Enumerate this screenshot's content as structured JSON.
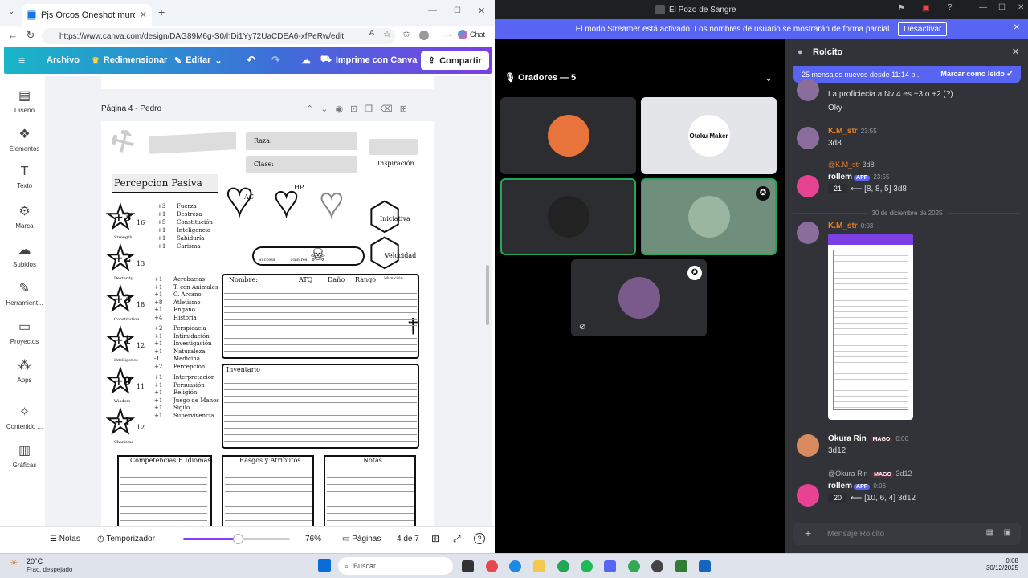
{
  "browser": {
    "tab_title": "Pjs Orcos Oneshot murder hobo",
    "new_tab_icon": "plus-icon",
    "url": "https://www.canva.com/design/DAG89M6g-S0/hDi1Yy72UaCDEA6-xfPeRw/edit",
    "chat_label": "Chat"
  },
  "canva": {
    "toolbar": {
      "archivo": "Archivo",
      "redimensionar": "Redimensionar",
      "editar": "Editar",
      "imprime": "Imprime con Canva",
      "compartir": "Compartir"
    },
    "sidebar": [
      {
        "label": "Diseño",
        "icon": "layout-icon"
      },
      {
        "label": "Elementos",
        "icon": "shapes-icon"
      },
      {
        "label": "Texto",
        "icon": "text-icon"
      },
      {
        "label": "Marca",
        "icon": "brand-icon"
      },
      {
        "label": "Subidos",
        "icon": "cloud-upload-icon"
      },
      {
        "label": "Herramient...",
        "icon": "tools-icon"
      },
      {
        "label": "Proyectos",
        "icon": "folder-icon"
      },
      {
        "label": "Apps",
        "icon": "apps-icon"
      },
      {
        "label": "Contenido ...",
        "icon": "magic-icon"
      },
      {
        "label": "Gráficas",
        "icon": "chart-icon"
      }
    ],
    "page_title": "Página 4 - Pedro",
    "sheet": {
      "raza": "Raza:",
      "clase": "Clase:",
      "inspiracion": "Inspiración",
      "percepcion": "Percepcion Pasiva",
      "ac": "AC",
      "hp": "HP",
      "iniciativa": "Iniciativa",
      "velocidad": "Velocidad",
      "exitos": "Success",
      "fallos": "Failures",
      "save_lines": [
        {
          "mod": "+3",
          "name": "Fuerza"
        },
        {
          "mod": "+1",
          "name": "Destreza"
        },
        {
          "mod": "+5",
          "name": "Constitución"
        },
        {
          "mod": "+1",
          "name": "Inteligencia"
        },
        {
          "mod": "+1",
          "name": "Sabiduría"
        },
        {
          "mod": "+1",
          "name": "Carisma"
        }
      ],
      "stats": [
        {
          "mod": "+3",
          "score": "16",
          "label": "Strength"
        },
        {
          "mod": "+2",
          "score": "13",
          "label": "Dexterity"
        },
        {
          "mod": "+3",
          "score": "18",
          "label": "Constitution"
        },
        {
          "mod": "+1",
          "score": "12",
          "label": "Intelligence"
        },
        {
          "mod": "+0",
          "score": "11",
          "label": "Wisdom"
        },
        {
          "mod": "+1",
          "score": "12",
          "label": "Charisma"
        }
      ],
      "skills": [
        {
          "mod": "+1",
          "name": "Acrobacias"
        },
        {
          "mod": "+1",
          "name": "T. con Animales"
        },
        {
          "mod": "+1",
          "name": "C. Arcano"
        },
        {
          "mod": "+8",
          "name": "Atletismo"
        },
        {
          "mod": "+1",
          "name": "Engaño"
        },
        {
          "mod": "+4",
          "name": "Historia"
        },
        {
          "mod": "+2",
          "name": "Perspicacia"
        },
        {
          "mod": "+1",
          "name": "Intimidación"
        },
        {
          "mod": "+1",
          "name": "Investigación"
        },
        {
          "mod": "+1",
          "name": "Naturaleza"
        },
        {
          "mod": "-1",
          "name": "Medicina"
        },
        {
          "mod": "+2",
          "name": "Percepción"
        },
        {
          "mod": "+1",
          "name": "Interpretación"
        },
        {
          "mod": "+1",
          "name": "Persuasión"
        },
        {
          "mod": "+1",
          "name": "Religión"
        },
        {
          "mod": "+1",
          "name": "Juego de Manos"
        },
        {
          "mod": "+1",
          "name": "Sigilo"
        },
        {
          "mod": "+1",
          "name": "Supervivencia"
        }
      ],
      "attack_cols": [
        "Nombre:",
        "ATQ",
        "Daño",
        "Rango",
        "Munición"
      ],
      "inventario": "Inventario",
      "competencias": "Competencias E Idiomas",
      "rasgos": "Rasgos y Atributos",
      "notas": "Notas"
    },
    "bottom": {
      "notas": "Notas",
      "temporizador": "Temporizador",
      "zoom": "76%",
      "zoom_level": 0.76,
      "paginas": "Páginas",
      "page_count": "4 de 7"
    }
  },
  "discord": {
    "title": "El Pozo de Sangre",
    "streamer_msg": "El modo Streamer está activado. Los nombres de usuario se mostrarán de forma parcial.",
    "desactivar": "Desactivar",
    "voice_header": "Oradores — 5",
    "tiles": [
      {
        "name": "tile-redhead",
        "color": "#e8743b"
      },
      {
        "name": "tile-otaku-maker",
        "avatar_text": "Otaku Maker"
      },
      {
        "name": "tile-black-cat",
        "color": "#222222"
      },
      {
        "name": "tile-white-dragon",
        "color": "#9ab5a0"
      },
      {
        "name": "tile-purple-elf",
        "color": "#7a5a8a"
      }
    ],
    "chat_title": "Rolcito",
    "new_messages": "25 mensajes nuevos desde 11:14 p...",
    "mark_read": "Marcar como leído",
    "messages": [
      {
        "text1": "La proficiecia a Nv 4 es +3 o +2 (?)",
        "text2": "Oky"
      },
      {
        "user": "K.M_str",
        "time": "23:55",
        "text": "3d8"
      },
      {
        "reply_user": "@K.M_str",
        "reply_text": "3d8",
        "user": "rollem",
        "tag": "APP",
        "time": "23:55",
        "result": "21",
        "detail": "⟵ [8, 8, 5] 3d8"
      },
      {
        "divider": "30 de diciembre de 2025"
      },
      {
        "user": "K.M_str",
        "time": "0:03"
      },
      {
        "user": "Okura Rin",
        "badge": "MAGO",
        "time": "0:06",
        "text": "3d12"
      },
      {
        "reply_user": "@Okura Rin",
        "reply_badge": "MAGO",
        "reply_text": "3d12",
        "user": "rollem",
        "tag": "APP",
        "time": "0:06",
        "result": "20",
        "detail": "⟵ [10, 6, 4] 3d12"
      }
    ],
    "input_placeholder": "Mensaje Rolcito"
  },
  "taskbar": {
    "weather_temp": "20°C",
    "weather_desc": "Frac. despejado",
    "search": "Buscar",
    "time": "0:08",
    "date": "30/12/2025"
  }
}
